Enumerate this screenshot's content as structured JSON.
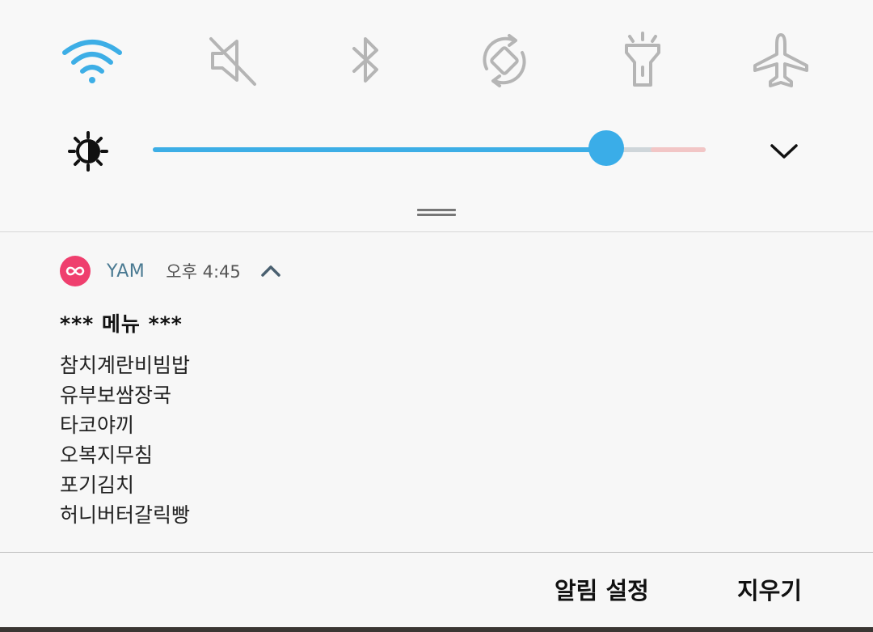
{
  "quick_settings": {
    "toggles": [
      {
        "id": "wifi",
        "icon": "wifi-icon",
        "active": true
      },
      {
        "id": "sound",
        "icon": "mute-icon",
        "active": false
      },
      {
        "id": "bluetooth",
        "icon": "bluetooth-icon",
        "active": false
      },
      {
        "id": "auto_rotate",
        "icon": "rotate-icon",
        "active": false
      },
      {
        "id": "flashlight",
        "icon": "flashlight-icon",
        "active": false
      },
      {
        "id": "airplane",
        "icon": "airplane-icon",
        "active": false
      }
    ],
    "brightness": {
      "icon": "brightness-icon",
      "level_fraction": 0.82,
      "expand_icon": "chevron-down-icon"
    },
    "colors": {
      "active": "#3daee6",
      "inactive": "#b5b5b5",
      "slider_fill": "#3daee6",
      "slider_thumb": "#3aade8",
      "slider_warn": "#f2c6c6"
    }
  },
  "notification": {
    "app_icon": "infinity-icon",
    "app_icon_color": "#ef3f6e",
    "app_name": "YAM",
    "time": "오후 4:45",
    "collapse_icon": "chevron-up-icon",
    "title": "*** 메뉴 ***",
    "lines": [
      "참치계란비빔밥",
      "유부보쌈장국",
      "타코야끼",
      "오복지무침",
      "포기김치",
      "허니버터갈릭빵"
    ]
  },
  "actions": {
    "settings_label": "알림 설정",
    "clear_label": "지우기"
  }
}
